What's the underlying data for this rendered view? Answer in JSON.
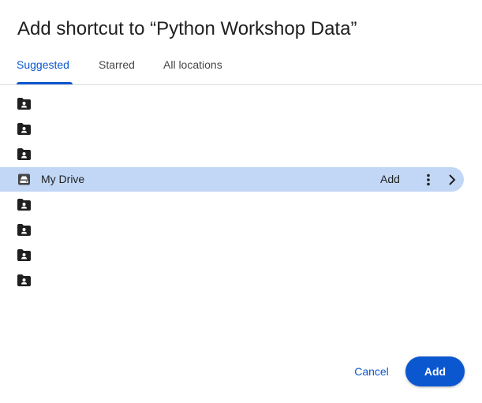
{
  "dialog": {
    "title": "Add shortcut to “Python Workshop Data”"
  },
  "tabs": [
    {
      "label": "Suggested",
      "active": true
    },
    {
      "label": "Starred",
      "active": false
    },
    {
      "label": "All locations",
      "active": false
    }
  ],
  "locations": [
    {
      "icon": "shared-folder-icon",
      "label": ""
    },
    {
      "icon": "shared-folder-icon",
      "label": ""
    },
    {
      "icon": "shared-folder-icon",
      "label": ""
    },
    {
      "icon": "drive-icon",
      "label": "My Drive",
      "selected": true,
      "add_label": "Add"
    },
    {
      "icon": "shared-folder-icon",
      "label": ""
    },
    {
      "icon": "shared-folder-icon",
      "label": ""
    },
    {
      "icon": "shared-folder-icon",
      "label": ""
    },
    {
      "icon": "shared-folder-icon",
      "label": ""
    }
  ],
  "footer": {
    "cancel_label": "Cancel",
    "add_label": "Add"
  },
  "colors": {
    "accent": "#0b57d0",
    "selected_row": "#c2d7f6"
  }
}
